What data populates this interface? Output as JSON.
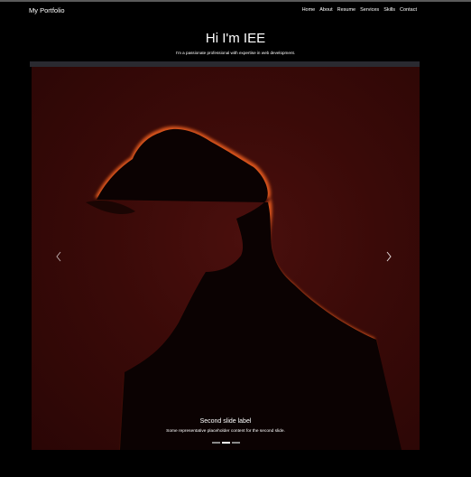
{
  "navbar": {
    "brand": "My Portfolio",
    "links": [
      "Home",
      "About",
      "Resume",
      "Services",
      "Skills",
      "Contact"
    ]
  },
  "hero": {
    "title": "Hi I'm IEE",
    "subtitle": "I'm a passionate professional with expertise in web development."
  },
  "carousel": {
    "slide_count": 3,
    "active_slide": 2,
    "caption_title": "Second slide label",
    "caption_text": "Some representative placeholder content for the second slide.",
    "prev_icon": "chevron-left-icon",
    "next_icon": "chevron-right-icon"
  },
  "colors": {
    "background": "#000000",
    "slide_background": "#3a0a08",
    "rim_light": "#d9541a",
    "silhouette": "#0b0202"
  }
}
